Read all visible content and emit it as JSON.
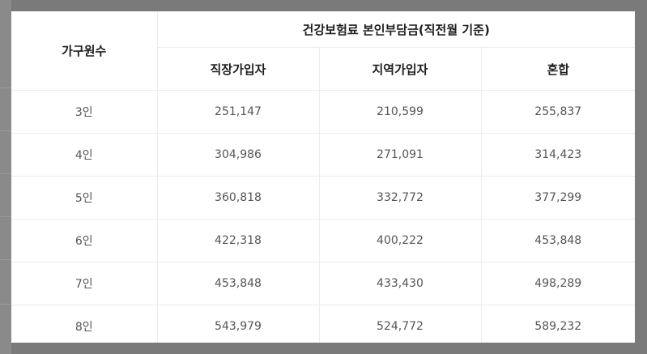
{
  "table": {
    "col_household": "가구원수",
    "group_header": "건강보험료 본인부담금(직전월 기준)",
    "sub_headers": [
      "직장가입자",
      "지역가입자",
      "혼합"
    ],
    "rows": [
      {
        "household": "3인",
        "workplace": "251,147",
        "regional": "210,599",
        "mixed": "255,837"
      },
      {
        "household": "4인",
        "workplace": "304,986",
        "regional": "271,091",
        "mixed": "314,423"
      },
      {
        "household": "5인",
        "workplace": "360,818",
        "regional": "332,772",
        "mixed": "377,299"
      },
      {
        "household": "6인",
        "workplace": "422,318",
        "regional": "400,222",
        "mixed": "453,848"
      },
      {
        "household": "7인",
        "workplace": "453,848",
        "regional": "433,430",
        "mixed": "498,289"
      },
      {
        "household": "8인",
        "workplace": "543,979",
        "regional": "524,772",
        "mixed": "589,232"
      }
    ]
  }
}
